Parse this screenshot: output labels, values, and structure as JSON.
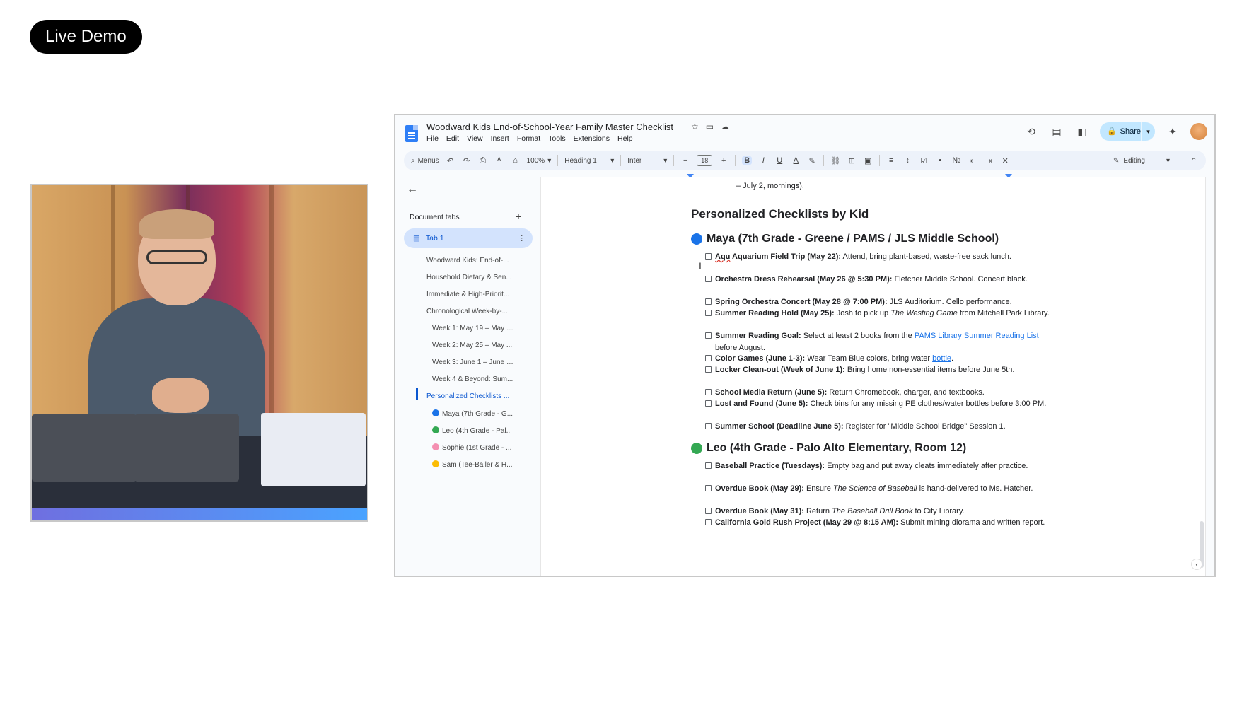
{
  "badge": {
    "label": "Live Demo"
  },
  "docs": {
    "title": "Woodward Kids End-of-School-Year Family Master Checklist",
    "menu": [
      "File",
      "Edit",
      "View",
      "Insert",
      "Format",
      "Tools",
      "Extensions",
      "Help"
    ],
    "share_label": "Share",
    "toolbar": {
      "menus_label": "Menus",
      "zoom": "100%",
      "style": "Heading 1",
      "font": "Inter",
      "font_size": "18",
      "mode": "Editing"
    },
    "sidebar": {
      "header": "Document tabs",
      "tab_label": "Tab 1",
      "outline": [
        {
          "label": "Woodward Kids: End-of-...",
          "indent": 0
        },
        {
          "label": "Household Dietary & Sen...",
          "indent": 0
        },
        {
          "label": "Immediate & High-Priorit...",
          "indent": 0
        },
        {
          "label": "Chronological Week-by-...",
          "indent": 0
        },
        {
          "label": "Week 1: May 19 – May 2...",
          "indent": 1
        },
        {
          "label": "Week 2: May 25 – May ...",
          "indent": 1
        },
        {
          "label": "Week 3: June 1 – June 5...",
          "indent": 1
        },
        {
          "label": "Week 4 & Beyond: Sum...",
          "indent": 1
        },
        {
          "label": "Personalized Checklists ...",
          "indent": 0,
          "active": true
        },
        {
          "label": "Maya (7th Grade - G...",
          "indent": 1,
          "dot": "#1a73e8"
        },
        {
          "label": "Leo (4th Grade - Pal...",
          "indent": 1,
          "dot": "#34a853"
        },
        {
          "label": "Sophie (1st Grade - ...",
          "indent": 1,
          "dot": "#f48fb1"
        },
        {
          "label": "Sam (Tee-Baller & H...",
          "indent": 1,
          "dot": "#fbbc04"
        }
      ]
    },
    "content": {
      "prev_line": "– July 2, mornings).",
      "heading": "Personalized Checklists by Kid",
      "maya": {
        "heading": "Maya (7th Grade - Greene / PAMS / JLS Middle School)",
        "color": "#1a73e8",
        "items": [
          {
            "typo": "Aqu",
            "bold": " Aquarium Field Trip (May 22):",
            "text": " Attend, bring plant-based, waste-free sack lunch."
          },
          {
            "bold": "Orchestra Dress Rehearsal (May 26 @ 5:30 PM):",
            "text": " Fletcher Middle School. Concert black."
          },
          {
            "bold": "Spring Orchestra Concert (May 28 @ 7:00 PM):",
            "text": " JLS Auditorium. Cello performance."
          },
          {
            "bold": "Summer Reading Hold (May 25):",
            "text": " Josh to pick up ",
            "italic": "The Westing Game",
            "text2": " from Mitchell Park Library."
          },
          {
            "bold": "Summer Reading Goal:",
            "text": " Select at least 2 books from the ",
            "link": "PAMS Library Summer Reading List",
            "text2": " before August."
          },
          {
            "bold": "Color Games (June 1-3):",
            "text": " Wear Team Blue colors, bring water ",
            "link": "bottle",
            "text2": "."
          },
          {
            "bold": "Locker Clean-out (Week of June 1):",
            "text": " Bring home non-essential items before June 5th."
          },
          {
            "bold": "School Media Return (June 5):",
            "text": " Return Chromebook, charger, and textbooks."
          },
          {
            "bold": "Lost and Found (June 5):",
            "text": " Check bins for any missing PE clothes/water bottles before 3:00 PM."
          },
          {
            "bold": "Summer School (Deadline June 5):",
            "text": " Register for \"Middle School Bridge\" Session 1."
          }
        ]
      },
      "leo": {
        "heading": "Leo (4th Grade - Palo Alto Elementary, Room 12)",
        "color": "#34a853",
        "items": [
          {
            "bold": "Baseball Practice (Tuesdays):",
            "text": " Empty bag and put away cleats immediately after practice."
          },
          {
            "bold": "Overdue Book (May 29):",
            "text": " Ensure ",
            "italic": "The Science of Baseball",
            "text2": " is hand-delivered to Ms. Hatcher."
          },
          {
            "bold": "Overdue Book (May 31):",
            "text": " Return ",
            "italic": "The Baseball Drill Book",
            "text2": " to City Library."
          },
          {
            "bold": "California Gold Rush Project (May 29 @ 8:15 AM):",
            "text": " Submit mining diorama and written report."
          }
        ]
      }
    }
  }
}
